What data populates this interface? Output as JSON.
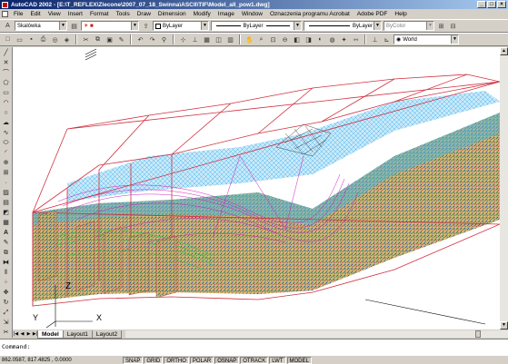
{
  "title": "AutoCAD 2002 - [E:\\T_REFLEX\\Zlecone\\2007_07_18_Swinna\\ASCII\\TIF\\Model_all_pow1.dwg]",
  "menu": [
    "File",
    "Edit",
    "View",
    "Insert",
    "Format",
    "Tools",
    "Draw",
    "Dimension",
    "Modify",
    "Image",
    "Window",
    "Oznaczenia programu Acrobat",
    "Adobe PDF",
    "Help"
  ],
  "toolbar": {
    "text_style": "Skalówka",
    "color": "ByLayer",
    "linetype": "ByLayer",
    "lineweight": "ByLayer",
    "plotstyle": "ByColor",
    "ucs": "World"
  },
  "colors": {
    "color_swatch": "#ffffff",
    "model_wire": "#d03040",
    "cyan": "#00c8d8",
    "magenta": "#d020c0"
  },
  "tabs": [
    "Model",
    "Layout1",
    "Layout2"
  ],
  "command_prompt": "Command:",
  "coordinates": "862.0587, 817.4825 , 0.0000",
  "status_toggles": [
    "SNAP",
    "GRID",
    "ORTHO",
    "POLAR",
    "OSNAP",
    "OTRACK",
    "LWT",
    "MODEL"
  ],
  "ucs_labels": {
    "z": "Z",
    "x": "X",
    "y": "Y"
  }
}
